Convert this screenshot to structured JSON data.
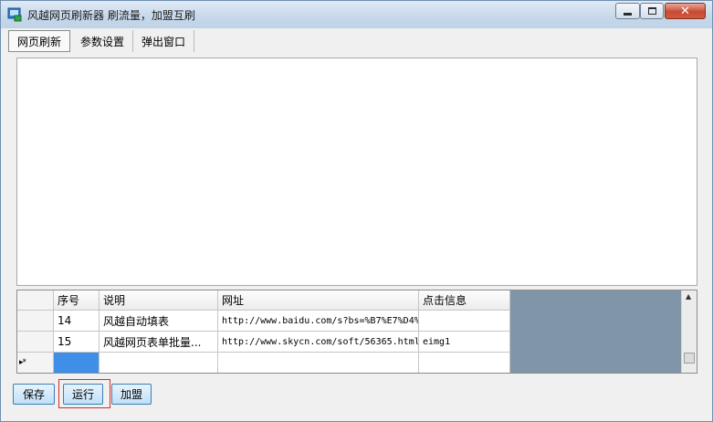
{
  "window": {
    "title": "风越网页刷新器 刷流量，加盟互刷",
    "close_glyph": "✕"
  },
  "tabs": [
    {
      "label": "网页刷新",
      "active": true
    },
    {
      "label": "参数设置",
      "active": false
    },
    {
      "label": "弹出窗口",
      "active": false
    }
  ],
  "grid": {
    "columns": [
      "序号",
      "说明",
      "网址",
      "点击信息"
    ],
    "rows": [
      {
        "no": "14",
        "desc": "风越自动填表",
        "url": "http://www.baidu.com/s?bs=%B7%E7%D4%",
        "info": ""
      },
      {
        "no": "15",
        "desc": "风越网页表单批量...",
        "url": "http://www.skycn.com/soft/56365.html",
        "info": "eimg1"
      }
    ],
    "new_row_marker": "▸*"
  },
  "buttons": {
    "save": "保存",
    "run": "运行",
    "join": "加盟"
  },
  "colors": {
    "selected_cell": "#3f8ee8",
    "run_highlight": "#d42b2b"
  }
}
